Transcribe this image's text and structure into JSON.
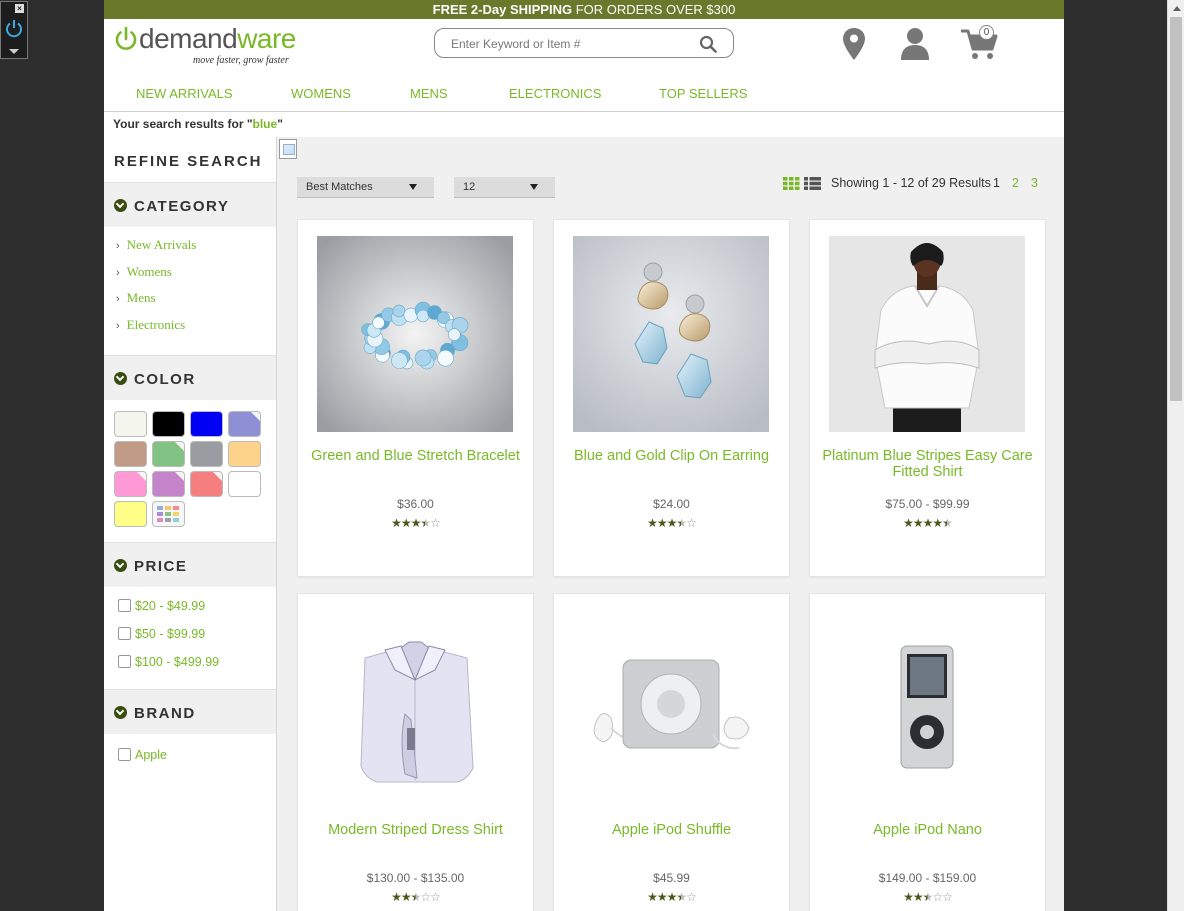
{
  "promo": {
    "bold_part": "FREE 2-Day SHIPPING",
    "rest": " FOR ORDERS OVER $300"
  },
  "logo": {
    "name_main": "demand",
    "name_accent": "ware",
    "tagline": "move faster, grow faster"
  },
  "search": {
    "placeholder": "Enter Keyword or Item #"
  },
  "cart": {
    "count": "0"
  },
  "nav": [
    "NEW ARRIVALS",
    "WOMENS",
    "MENS",
    "ELECTRONICS",
    "TOP SELLERS"
  ],
  "results": {
    "prefix": "Your search results for \"",
    "term": "blue",
    "suffix": "\""
  },
  "refine": {
    "title": "REFINE SEARCH"
  },
  "category": {
    "title": "CATEGORY",
    "items": [
      "New Arrivals",
      "Womens",
      "Mens",
      "Electronics"
    ]
  },
  "color": {
    "title": "COLOR",
    "swatches": [
      "#f4f5ec",
      "#000000",
      "#0000f5",
      "#8f8fd6",
      "#c19b86",
      "#82c285",
      "#999ca0",
      "#fdd28a",
      "#ff99d5",
      "#c583c9",
      "#f57f7f",
      "#ffffff",
      "#ffff88",
      "multi"
    ]
  },
  "price": {
    "title": "PRICE",
    "ranges": [
      "$20 - $49.99",
      "$50 - $99.99",
      "$100 - $499.99"
    ]
  },
  "brand": {
    "title": "BRAND",
    "items": [
      "Apple"
    ]
  },
  "sort": {
    "selected": "Best Matches"
  },
  "page_size": {
    "selected": "12"
  },
  "paging": {
    "showing": "Showing 1 - 12 of 29 Results",
    "current": "1",
    "pages": [
      "2",
      "3"
    ]
  },
  "products": [
    {
      "name": "Green and Blue Stretch Bracelet",
      "price": "$36.00",
      "rating": 3.5
    },
    {
      "name": "Blue and Gold Clip On Earring",
      "price": "$24.00",
      "rating": 3.5
    },
    {
      "name": "Platinum Blue Stripes Easy Care Fitted Shirt",
      "price": "$75.00 - $99.99",
      "rating": 4.5
    },
    {
      "name": "Modern Striped Dress Shirt",
      "price": "$130.00 - $135.00",
      "rating": 2.5
    },
    {
      "name": "Apple iPod Shuffle",
      "price": "$45.99",
      "rating": 3.5
    },
    {
      "name": "Apple iPod Nano",
      "price": "$149.00 - $159.00",
      "rating": 2.5
    }
  ],
  "colors": {
    "brand_green": "#79b928",
    "promo_bar": "#69792b",
    "star": "#4a5b1c"
  }
}
